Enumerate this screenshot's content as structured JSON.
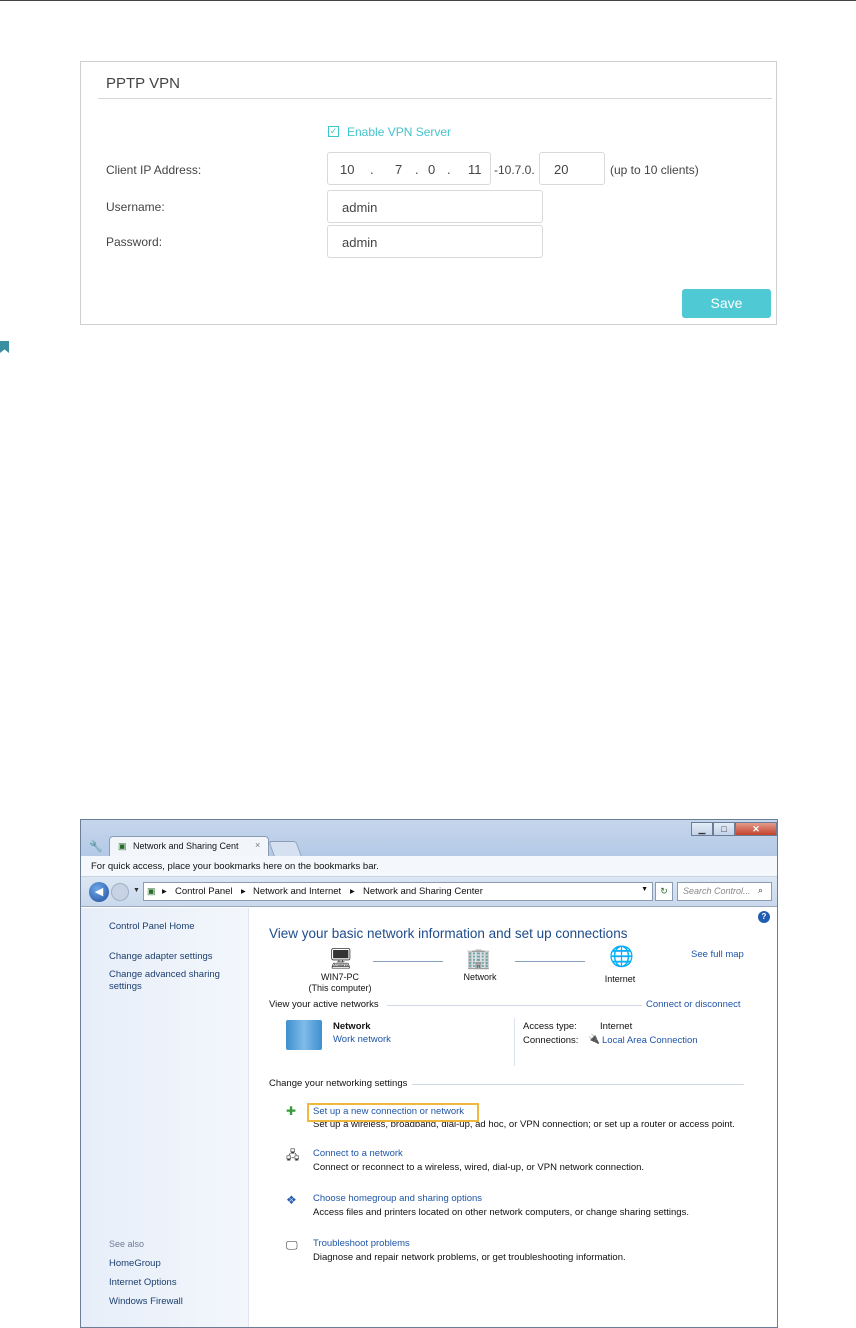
{
  "vpn": {
    "title": "PPTP VPN",
    "enable_label": "Enable VPN Server",
    "client_ip_label": "Client IP Address:",
    "ip": [
      "10",
      "7",
      "0",
      "11"
    ],
    "dot": ".",
    "range_prefix": "-10.7.0.",
    "range_end": "20",
    "range_note": "(up to 10 clients)",
    "username_label": "Username:",
    "username": "admin",
    "password_label": "Password:",
    "password": "admin",
    "save_label": "Save"
  },
  "browser": {
    "tab_title": "Network and Sharing Cent",
    "tab_close": "×",
    "bookmarks_hint": "For quick access, place your bookmarks here on the bookmarks bar.",
    "breadcrumb": [
      "Control Panel",
      "Network and Internet",
      "Network and Sharing Center"
    ],
    "search_placeholder": "Search Control..."
  },
  "sidebar": {
    "items": [
      "Control Panel Home",
      "Change adapter settings",
      "Change advanced sharing settings"
    ],
    "see_also": "See also",
    "see_also_items": [
      "HomeGroup",
      "Internet Options",
      "Windows Firewall"
    ]
  },
  "main": {
    "title": "View your basic network information and set up connections",
    "see_full_map": "See full map",
    "nodes": {
      "computer_name": "WIN7-PC",
      "computer_sub": "(This computer)",
      "network": "Network",
      "internet": "Internet"
    },
    "active_networks": "View your active networks",
    "connect_disconnect": "Connect or disconnect",
    "network_name": "Network",
    "network_type": "Work network",
    "access_type_label": "Access type:",
    "access_type": "Internet",
    "connections_label": "Connections:",
    "connection": "Local Area Connection",
    "change_settings": "Change your networking settings",
    "tasks": [
      {
        "title": "Set up a new connection or network",
        "desc": "Set up a wireless, broadband, dial-up, ad hoc, or VPN connection; or set up a router or access point."
      },
      {
        "title": "Connect to a network",
        "desc": "Connect or reconnect to a wireless, wired, dial-up, or VPN network connection."
      },
      {
        "title": "Choose homegroup and sharing options",
        "desc": "Access files and printers located on other network computers, or change sharing settings."
      },
      {
        "title": "Troubleshoot problems",
        "desc": "Diagnose and repair network problems, or get troubleshooting information."
      }
    ]
  },
  "colors": {
    "accent": "#4fc9d3",
    "link": "#1e55a8",
    "highlight": "#f0b83c"
  }
}
